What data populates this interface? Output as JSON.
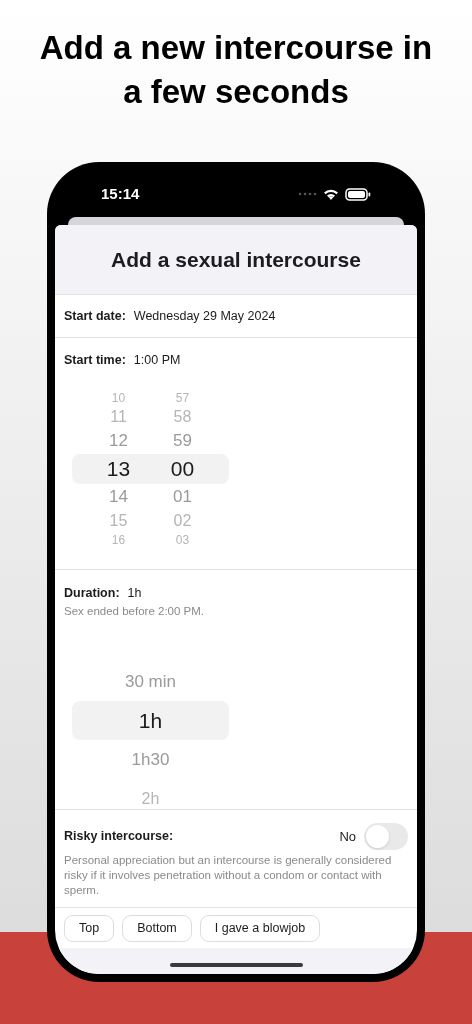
{
  "heading": "Add a new intercourse in a few seconds",
  "status_bar": {
    "time": "15:14"
  },
  "sheet": {
    "title": "Add a sexual intercourse"
  },
  "start_date": {
    "label": "Start date:",
    "value": "Wednesday 29 May 2024"
  },
  "start_time": {
    "label": "Start time:",
    "value": "1:00 PM",
    "hours": [
      {
        "text": "10",
        "selected": false
      },
      {
        "text": "11",
        "selected": false
      },
      {
        "text": "12",
        "selected": false
      },
      {
        "text": "13",
        "selected": true
      },
      {
        "text": "14",
        "selected": false
      },
      {
        "text": "15",
        "selected": false
      },
      {
        "text": "16",
        "selected": false
      }
    ],
    "minutes": [
      {
        "text": "57",
        "selected": false
      },
      {
        "text": "58",
        "selected": false
      },
      {
        "text": "59",
        "selected": false
      },
      {
        "text": "00",
        "selected": true
      },
      {
        "text": "01",
        "selected": false
      },
      {
        "text": "02",
        "selected": false
      },
      {
        "text": "03",
        "selected": false
      }
    ]
  },
  "duration": {
    "label": "Duration:",
    "value": "1h",
    "note": "Sex ended before 2:00 PM.",
    "options": [
      {
        "text": "30 min",
        "selected": false
      },
      {
        "text": "1h",
        "selected": true
      },
      {
        "text": "1h30",
        "selected": false
      },
      {
        "text": "2h",
        "selected": false
      }
    ]
  },
  "risky": {
    "label": "Risky intercourse:",
    "state_text": "No",
    "on": false,
    "description": "Personal appreciation but an intercourse is generally considered risky if it involves penetration without a condom or contact with sperm."
  },
  "tags": [
    {
      "label": "Top",
      "selected": false
    },
    {
      "label": "Bottom",
      "selected": false
    },
    {
      "label": "I gave a blowjob",
      "selected": false
    }
  ]
}
